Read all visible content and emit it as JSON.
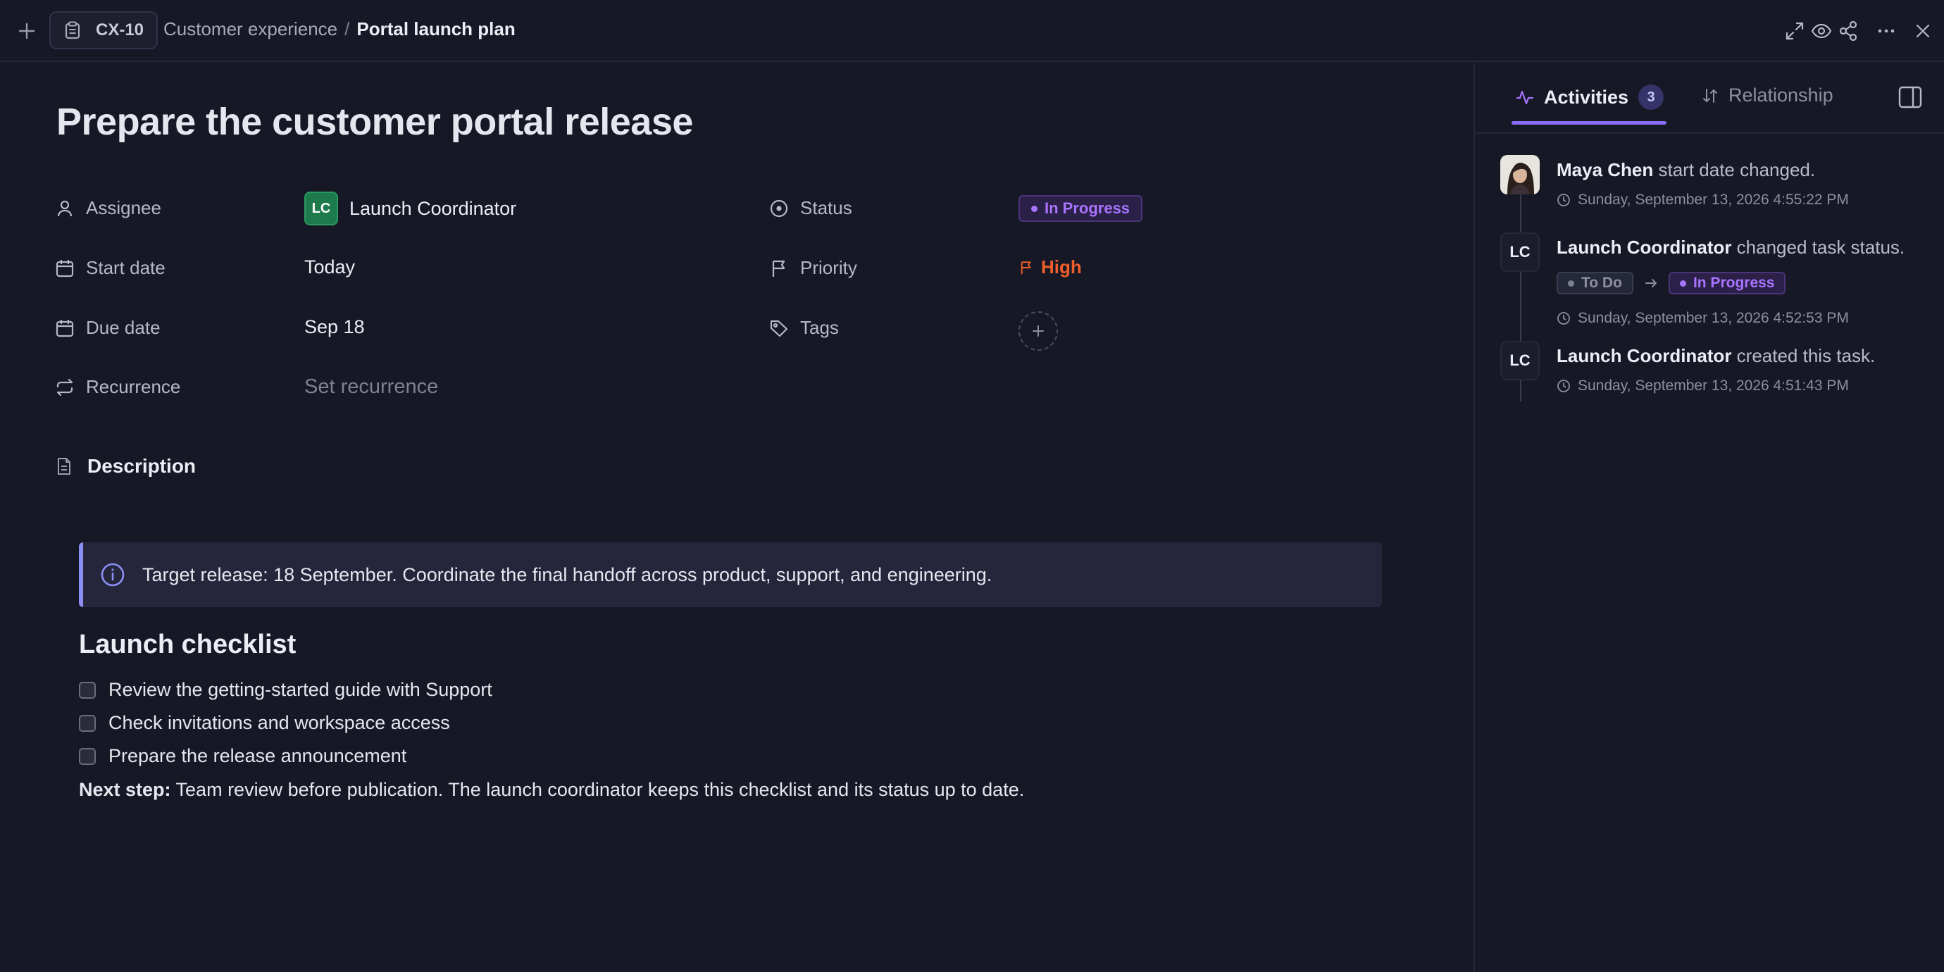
{
  "topbar": {
    "issue_id": "CX-10",
    "breadcrumb": {
      "parent": "Customer experience",
      "separator": "/",
      "current": "Portal launch plan"
    }
  },
  "task": {
    "title": "Prepare the customer portal release",
    "properties": {
      "assignee": {
        "label": "Assignee",
        "initials": "LC",
        "value": "Launch Coordinator"
      },
      "start_date": {
        "label": "Start date",
        "value": "Today"
      },
      "due_date": {
        "label": "Due date",
        "value": "Sep 18"
      },
      "recurrence": {
        "label": "Recurrence",
        "placeholder": "Set recurrence"
      },
      "status": {
        "label": "Status",
        "value": "In Progress"
      },
      "priority": {
        "label": "Priority",
        "value": "High"
      },
      "tags": {
        "label": "Tags"
      }
    },
    "description": {
      "label": "Description",
      "callout": "Target release: 18 September. Coordinate the final handoff across product, support, and engineering.",
      "checklist_title": "Launch checklist",
      "checklist": [
        "Review the getting-started guide with Support",
        "Check invitations and workspace access",
        "Prepare the release announcement"
      ],
      "next_step_label": "Next step:",
      "next_step_text": " Team review before publication. The launch coordinator keeps this checklist and its status up to date."
    }
  },
  "side_panel": {
    "tabs": [
      {
        "label": "Activities",
        "count": "3"
      },
      {
        "label": "Relationship"
      }
    ],
    "activities": [
      {
        "actor": "Maya Chen",
        "action": " start date changed.",
        "time": "Sunday, September 13, 2026 4:55:22 PM"
      },
      {
        "actor": "Launch Coordinator",
        "initials": "LC",
        "action": " changed task status.",
        "from": "To Do",
        "to": "In Progress",
        "time": "Sunday, September 13, 2026 4:52:53 PM"
      },
      {
        "actor": "Launch Coordinator",
        "initials": "LC",
        "action": " created this task.",
        "time": "Sunday, September 13, 2026 4:51:43 PM"
      }
    ]
  },
  "colors": {
    "background": "#161825",
    "accent": "#8b6cf6",
    "status_in_progress": "#a874ff",
    "priority_high": "#f05f2b",
    "assignee_avatar": "#1c7a4b"
  },
  "icons": [
    "plus-icon",
    "clipboard-icon",
    "expand-icon",
    "eye-icon",
    "share-icon",
    "more-icon",
    "close-icon",
    "user-icon",
    "calendar-icon",
    "repeat-icon",
    "status-circle-icon",
    "flag-icon",
    "tag-icon",
    "document-icon",
    "info-icon",
    "activity-icon",
    "sort-icon",
    "panel-icon",
    "clock-icon"
  ]
}
